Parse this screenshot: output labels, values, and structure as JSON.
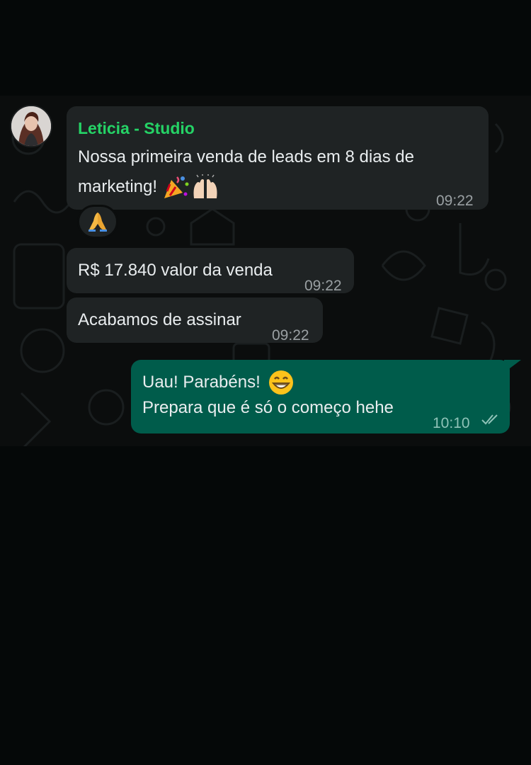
{
  "contact": {
    "name": "Leticia - Studio"
  },
  "messages": [
    {
      "direction": "incoming",
      "lines": [
        "Nossa primeira venda de leads em 8 dias de",
        "marketing!"
      ],
      "emojis": [
        "party-popper",
        "raised-hands"
      ],
      "time": "09:22",
      "reaction": "folded-hands"
    },
    {
      "direction": "incoming",
      "text": "R$ 17.840 valor da venda",
      "time": "09:22"
    },
    {
      "direction": "incoming",
      "text": "Acabamos de assinar",
      "time": "09:22"
    },
    {
      "direction": "outgoing",
      "lines": [
        "Uau! Parabéns!",
        "Prepara que é só o começo hehe"
      ],
      "emojis": [
        "grinning-face"
      ],
      "time": "10:10",
      "status": "read"
    }
  ],
  "colors": {
    "incoming_bubble": "#1f2324",
    "outgoing_bubble": "#005c4b",
    "sender_name": "#25d366",
    "text": "#e9edef",
    "timestamp": "#9aa0a3"
  }
}
